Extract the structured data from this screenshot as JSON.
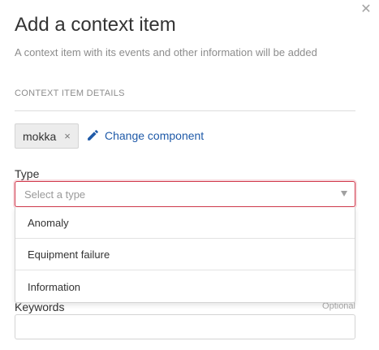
{
  "dialog": {
    "title": "Add a context item",
    "subtitle": "A context item with its events and other information will be added",
    "close_icon": "close-icon"
  },
  "details": {
    "section_label": "CONTEXT ITEM DETAILS",
    "component_chip": {
      "label": "mokka",
      "remove_glyph": "×"
    },
    "change_component": {
      "label": "Change component",
      "icon": "pencil-icon"
    }
  },
  "type_field": {
    "label": "Type",
    "placeholder": "Select a type",
    "arrow_icon": "chevron-down-icon",
    "error_color": "#d13a4d",
    "dropdown_open": true,
    "options": [
      {
        "label": "Anomaly"
      },
      {
        "label": "Equipment failure"
      },
      {
        "label": "Information"
      }
    ]
  },
  "keywords_field": {
    "label": "Keywords",
    "optional_label": "Optional",
    "value": ""
  },
  "colors": {
    "link": "#1f5aa8",
    "error": "#d13a4d",
    "muted_text": "#8c8c8c"
  }
}
